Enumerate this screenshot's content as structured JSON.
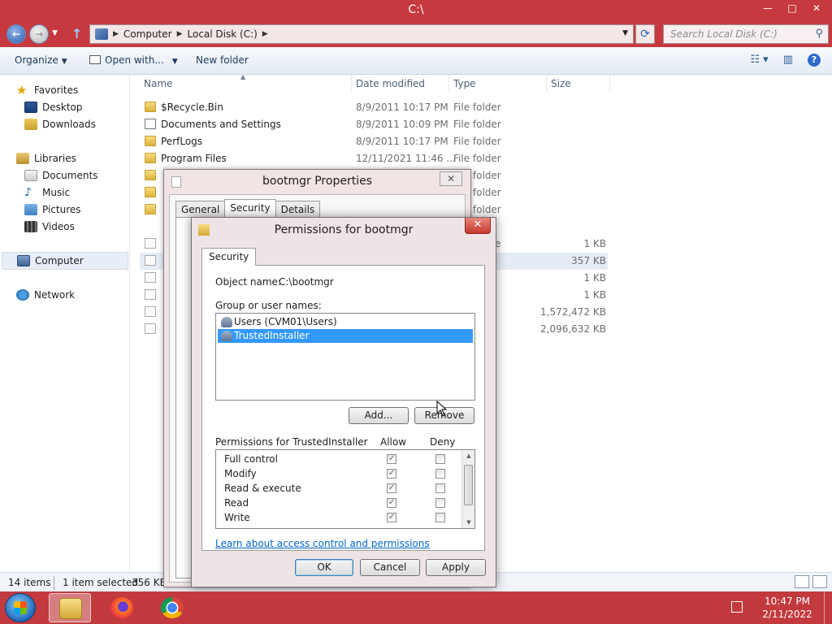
{
  "window": {
    "title": "C:\\",
    "controls": {
      "minimize": "—",
      "maximize": "□",
      "close": "✕"
    }
  },
  "address": {
    "crumbs": [
      "Computer",
      "Local Disk (C:)"
    ],
    "search_placeholder": "Search Local Disk (C:)"
  },
  "toolbar": {
    "organize": "Organize",
    "open_with": "Open with...",
    "new_folder": "New folder"
  },
  "nav": {
    "favorites": "Favorites",
    "desktop": "Desktop",
    "downloads": "Downloads",
    "libraries": "Libraries",
    "documents": "Documents",
    "music": "Music",
    "pictures": "Pictures",
    "videos": "Videos",
    "computer": "Computer",
    "network": "Network"
  },
  "filelist": {
    "columns": {
      "name": "Name",
      "date": "Date modified",
      "type": "Type",
      "size": "Size"
    },
    "rows": [
      {
        "name": "$Recycle.Bin",
        "date": "8/9/2011 10:17 PM",
        "type": "File folder",
        "size": ""
      },
      {
        "name": "Documents and Settings",
        "date": "8/9/2011 10:09 PM",
        "type": "File folder",
        "size": ""
      },
      {
        "name": "PerfLogs",
        "date": "8/9/2011 10:17 PM",
        "type": "File folder",
        "size": ""
      },
      {
        "name": "Program Files",
        "date": "12/11/2021 11:46 ...",
        "type": "File folder",
        "size": ""
      },
      {
        "name": "",
        "date": "",
        "type": "File folder",
        "size": ""
      },
      {
        "name": "",
        "date": "",
        "type": "File folder",
        "size": ""
      },
      {
        "name": "",
        "date": "",
        "type": "File folder",
        "size": ""
      },
      {
        "name": "",
        "date": "",
        "type": "Batch File",
        "size": "1 KB"
      },
      {
        "name": "",
        "date": "",
        "type": "",
        "size": "357 KB"
      },
      {
        "name": "",
        "date": "",
        "type": "",
        "size": "1 KB"
      },
      {
        "name": "",
        "date": "",
        "type": "",
        "size": "1 KB"
      },
      {
        "name": "",
        "date": "",
        "type": "",
        "size": "1,572,472 KB"
      },
      {
        "name": "",
        "date": "",
        "type": "",
        "size": "2,096,632 KB"
      }
    ]
  },
  "status": {
    "items": "14 items",
    "selected": "1 item selected",
    "size": "356 KB"
  },
  "props": {
    "title": "bootmgr Properties",
    "tabs": [
      "General",
      "Security",
      "Details"
    ],
    "close": "✕"
  },
  "perm": {
    "title": "Permissions for bootmgr",
    "close": "✕",
    "tab": "Security",
    "object_label": "Object name:",
    "object_value": "C:\\bootmgr",
    "group_label": "Group or user names:",
    "groups": [
      "Users (CVM01\\Users)",
      "TrustedInstaller"
    ],
    "add": "Add...",
    "remove": "Remove",
    "permissions_for": "Permissions for TrustedInstaller",
    "allow": "Allow",
    "deny": "Deny",
    "permissions": [
      {
        "name": "Full control",
        "allow": true,
        "deny": false
      },
      {
        "name": "Modify",
        "allow": true,
        "deny": false
      },
      {
        "name": "Read & execute",
        "allow": true,
        "deny": false
      },
      {
        "name": "Read",
        "allow": true,
        "deny": false
      },
      {
        "name": "Write",
        "allow": true,
        "deny": false
      }
    ],
    "learn_link": "Learn about access control and permissions",
    "ok": "OK",
    "cancel": "Cancel",
    "apply": "Apply"
  },
  "taskbar": {
    "time": "10:47 PM",
    "date": "2/11/2022"
  }
}
